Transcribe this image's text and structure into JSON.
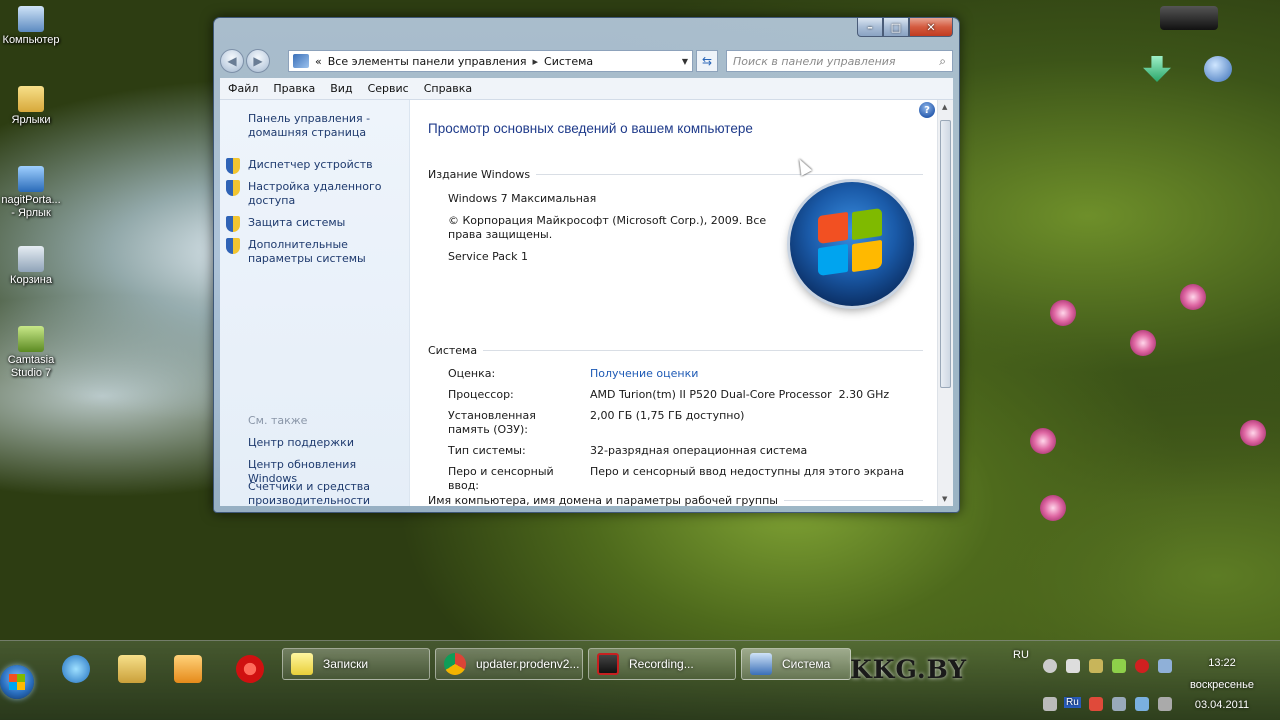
{
  "desktop": {
    "icons": [
      {
        "label": "Компьютер"
      },
      {
        "label": "Ярлыки"
      },
      {
        "label": "nagitPorta... - Ярлык"
      },
      {
        "label": "Корзина"
      },
      {
        "label": "Camtasia Studio 7"
      }
    ]
  },
  "window": {
    "controls": {
      "minimize": "–",
      "maximize": "□",
      "close": "✕"
    },
    "breadcrumb": {
      "root": "«",
      "parent": "Все элементы панели управления",
      "current": "Система"
    },
    "search_placeholder": "Поиск в панели управления",
    "menu": [
      "Файл",
      "Правка",
      "Вид",
      "Сервис",
      "Справка"
    ],
    "left_pane": {
      "home": "Панель управления - домашняя страница",
      "tasks": [
        "Диспетчер устройств",
        "Настройка удаленного доступа",
        "Защита системы",
        "Дополнительные параметры системы"
      ],
      "see_also_title": "См. также",
      "see_also": [
        "Центр поддержки",
        "Центр обновления Windows",
        "Счетчики и средства производительности"
      ]
    },
    "main": {
      "title": "Просмотр основных сведений о вашем компьютере",
      "edition_header": "Издание Windows",
      "edition": "Windows 7 Максимальная",
      "copyright": "© Корпорация Майкрософт (Microsoft Corp.), 2009. Все права защищены.",
      "service_pack": "Service Pack 1",
      "system_header": "Система",
      "rows": [
        {
          "label": "Оценка:",
          "value": "Получение оценки"
        },
        {
          "label": "Процессор:",
          "value": "AMD Turion(tm) II P520 Dual-Core Processor  2.30 GHz"
        },
        {
          "label": "Установленная память (ОЗУ):",
          "value": "2,00 ГБ (1,75 ГБ доступно)"
        },
        {
          "label": "Тип системы:",
          "value": "32-разрядная операционная система"
        },
        {
          "label": "Перо и сенсорный ввод:",
          "value": "Перо и сенсорный ввод недоступны для этого экрана"
        }
      ],
      "computer_header": "Имя компьютера, имя домена и параметры рабочей группы"
    }
  },
  "taskbar": {
    "tasks": [
      {
        "label": "Записки"
      },
      {
        "label": "updater.prodenv2..."
      },
      {
        "label": "Recording..."
      },
      {
        "label": "Система"
      }
    ],
    "language": "RU",
    "watermark": "KKG.BY",
    "time": "13:22",
    "day": "воскресенье",
    "date": "03.04.2011",
    "lang_badge": "Ru"
  },
  "colors": {
    "link": "#1e5ab5",
    "title": "#1e3a8a",
    "pane_link": "#1e3a6e"
  }
}
